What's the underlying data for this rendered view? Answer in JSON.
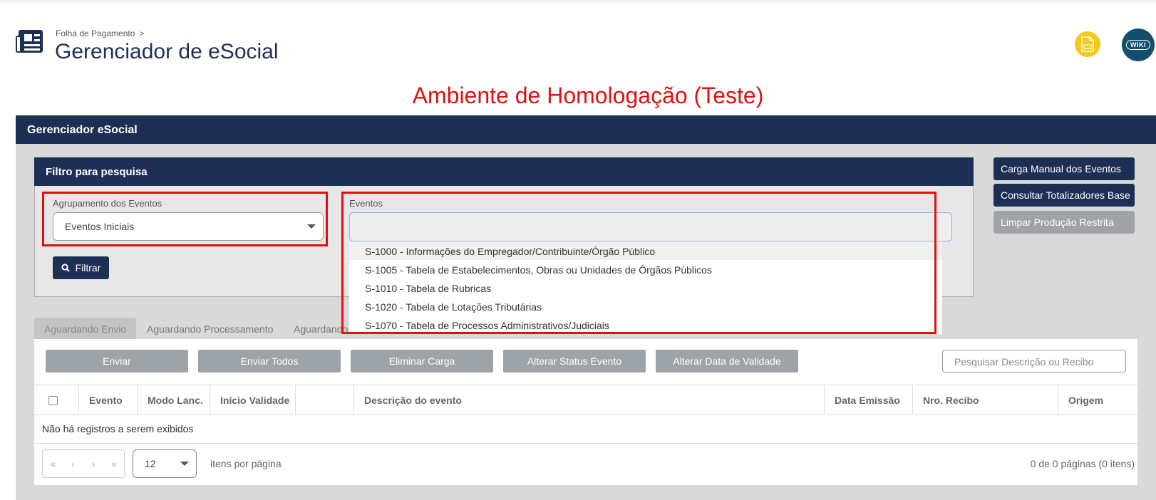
{
  "header": {
    "breadcrumb": "Folha de Pagamento",
    "breadcrumb_sep": ">",
    "title": "Gerenciador de eSocial",
    "wiki_label": "WIKI"
  },
  "environment_title": "Ambiente de Homologação (Teste)",
  "panel": {
    "title": "Gerenciador eSocial"
  },
  "filter": {
    "title": "Filtro para pesquisa",
    "grouping_label": "Agrupamento dos Eventos",
    "grouping_value": "Eventos Iniciais",
    "events_label": "Eventos",
    "events_value": "",
    "filter_button": "Filtrar",
    "dropdown_options": [
      "S-1000 - Informações do Empregador/Contribuinte/Órgão Público",
      "S-1005 - Tabela de Estabelecimentos, Obras ou Unidades de Órgãos Públicos",
      "S-1010 - Tabela de Rubricas",
      "S-1020 - Tabela de Lotações Tributárias",
      "S-1070 - Tabela de Processos Administrativos/Judiciais"
    ]
  },
  "side_buttons": [
    "Carga Manual dos Eventos",
    "Consultar Totalizadores Base",
    "Limpar Produção Restrita"
  ],
  "tabs": [
    "Aguardando Envio",
    "Aguardando Processamento",
    "Aguardando"
  ],
  "actions": [
    "Enviar",
    "Enviar Todos",
    "Eliminar Carga",
    "Alterar Status Evento",
    "Alterar Data de Validade"
  ],
  "search": {
    "placeholder": "Pesquisar Descrição ou Recibo"
  },
  "table": {
    "columns": [
      "Evento",
      "Modo Lanc.",
      "Início Validade",
      "",
      "Descrição do evento",
      "Data Emissão",
      "Nro. Recibo",
      "Origem"
    ],
    "empty_message": "Não há registros a serem exibidos"
  },
  "pagination": {
    "page_size": "12",
    "per_page_label": "itens por página",
    "info": "0 de 0 páginas (0 itens)"
  },
  "colors": {
    "navy": "#1e2f55",
    "highlight_red": "#e01010",
    "disabled_gray": "#9ea3a8"
  }
}
